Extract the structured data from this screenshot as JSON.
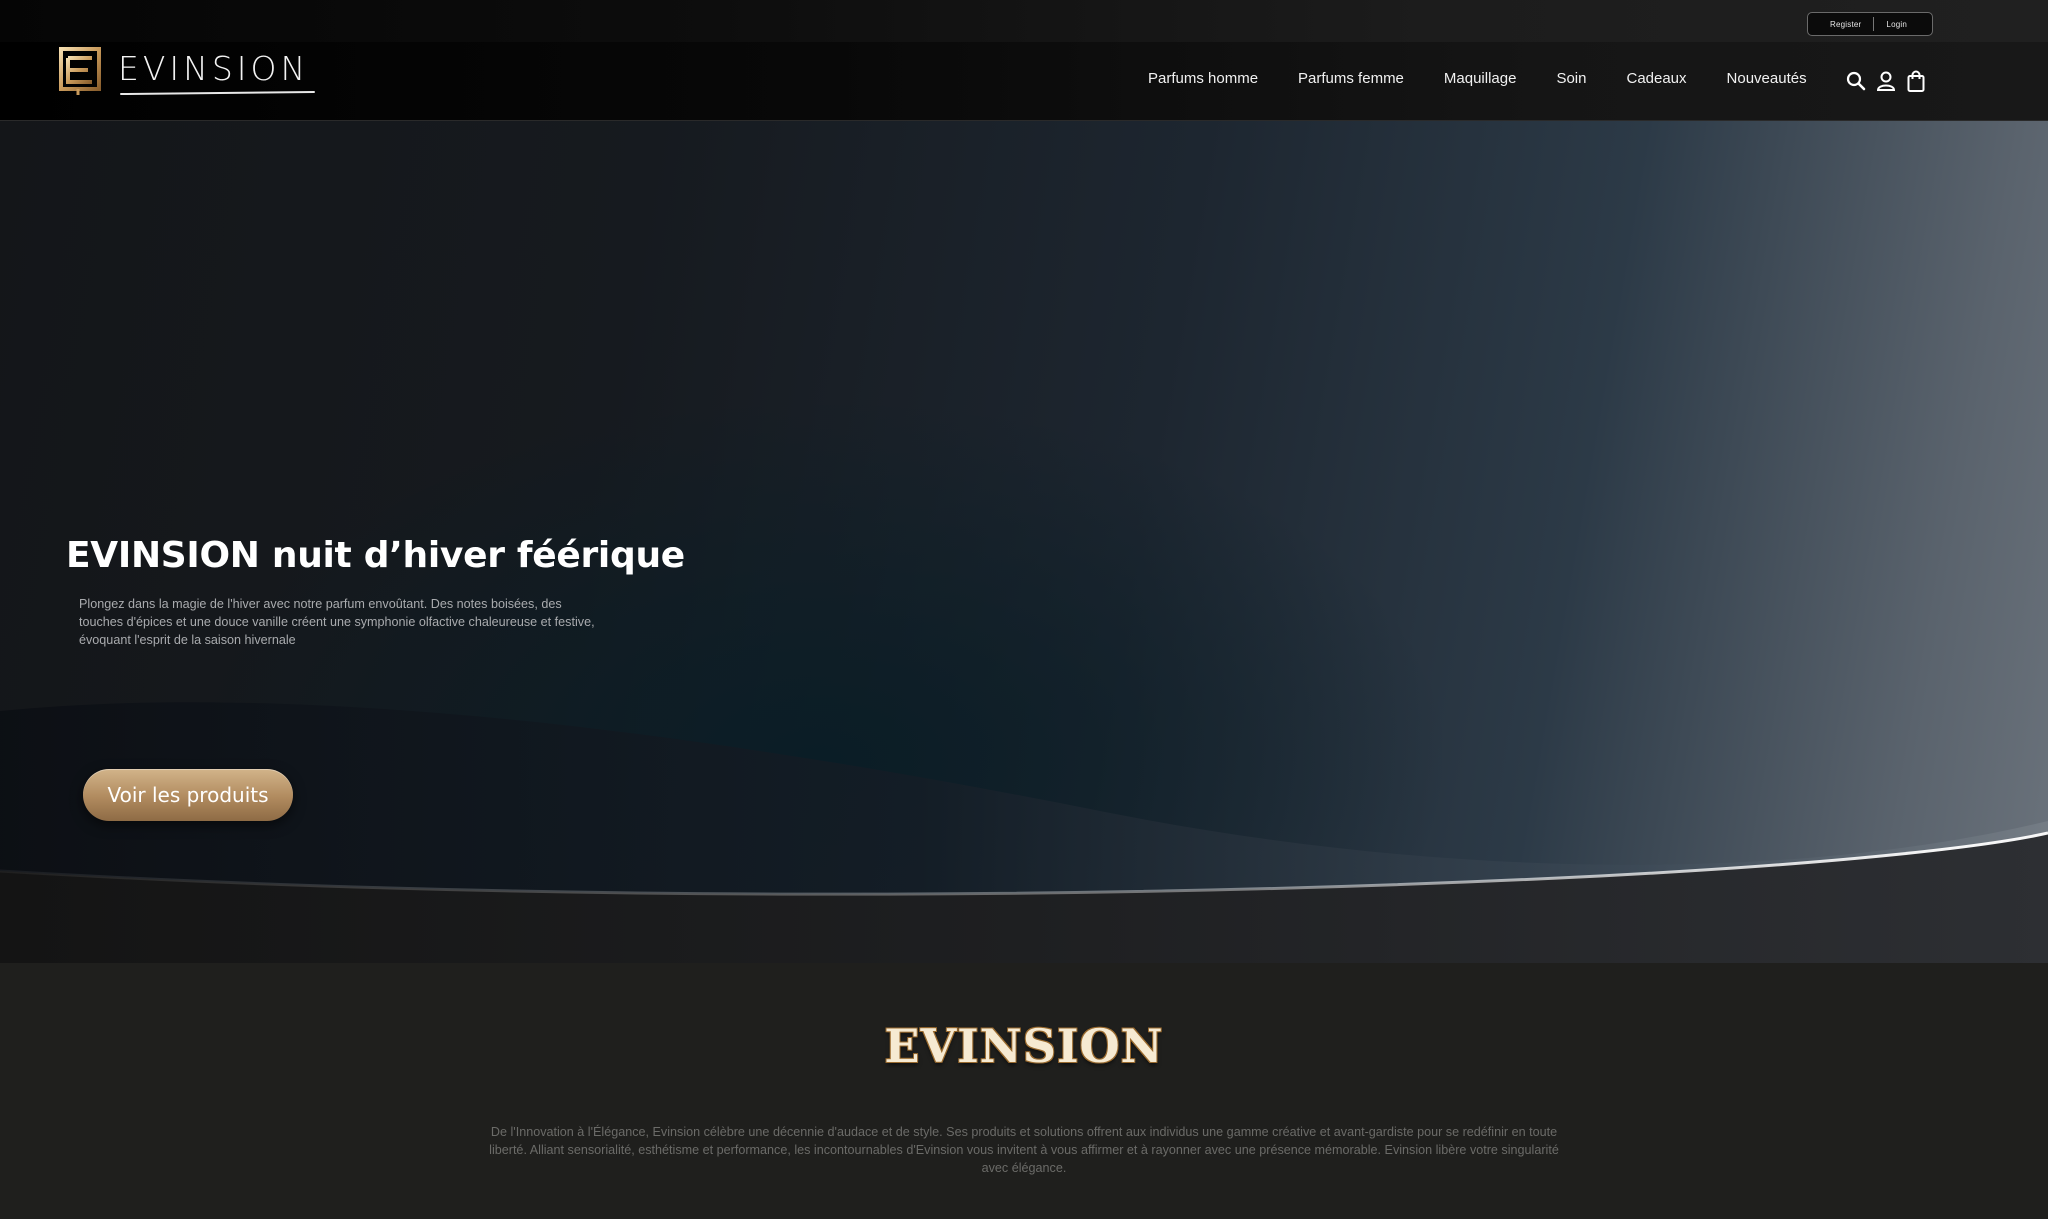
{
  "auth": {
    "register_label": "Register",
    "login_label": "Login"
  },
  "header": {
    "brand_name": "EVINSION",
    "nav": [
      "Parfums homme",
      "Parfums femme",
      "Maquillage",
      "Soin",
      "Cadeaux",
      "Nouveautés"
    ],
    "icons": [
      "search-icon",
      "user-icon",
      "shopping-bag-icon"
    ]
  },
  "hero": {
    "title": "EVINSION nuit d’hiver féérique",
    "description": "Plongez dans la magie de l'hiver avec notre parfum envoûtant. Des notes boisées, des touches d'épices et une douce vanille créent une symphonie olfactive chaleureuse et festive, évoquant l'esprit de la saison hivernale",
    "cta_label": "Voir les produits"
  },
  "brand": {
    "title": "EVINSION",
    "description": "De l'Innovation à l'Élégance, Evinsion célèbre une décennie d'audace et de style. Ses produits et solutions offrent aux individus une gamme créative et avant-gardiste pour se redéfinir en toute liberté. Alliant sensorialité, esthétisme et performance, les incontournables d'Evinsion vous invitent à vous affirmer et à rayonner avec une présence mémorable. Evinsion libère votre singularité avec élégance."
  },
  "colors": {
    "accent_gold": "#b08a5e",
    "brand_title_cream": "#f6ead2",
    "background_dark": "#1f1f1d"
  }
}
